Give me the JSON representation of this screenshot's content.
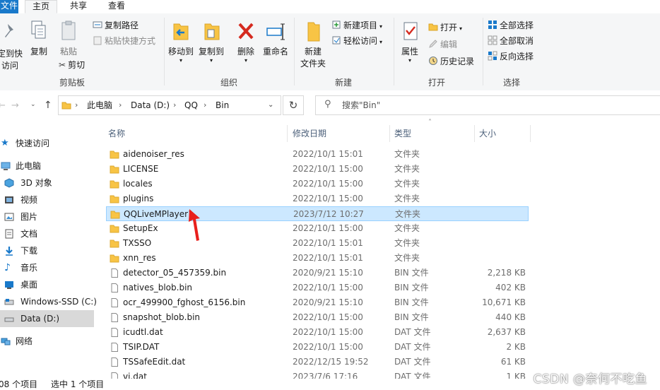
{
  "ribbon_tabs": {
    "file": "文件",
    "home": "主页",
    "share": "共享",
    "view": "查看"
  },
  "ribbon": {
    "clipboard": {
      "pin_label_1": "定到快",
      "pin_label_2": "访问",
      "copy": "复制",
      "paste": "粘贴",
      "copy_path": "复制路径",
      "paste_shortcut": "粘贴快捷方式",
      "cut": "剪切",
      "group": "剪贴板"
    },
    "organize": {
      "move_to": "移动到",
      "copy_to": "复制到",
      "delete": "删除",
      "rename": "重命名",
      "group": "组织"
    },
    "new": {
      "new_folder_1": "新建",
      "new_folder_2": "文件夹",
      "new_item": "新建项目",
      "easy_access": "轻松访问",
      "group": "新建"
    },
    "open": {
      "properties": "属性",
      "open": "打开",
      "edit": "编辑",
      "history": "历史记录",
      "group": "打开"
    },
    "select": {
      "select_all": "全部选择",
      "select_none": "全部取消",
      "invert": "反向选择",
      "group": "选择"
    }
  },
  "address": {
    "breadcrumbs": [
      "此电脑",
      "Data (D:)",
      "QQ",
      "Bin"
    ],
    "search_placeholder": "搜索\"Bin\""
  },
  "nav_pane": [
    {
      "label": "快速访问",
      "icon": "star-icon"
    },
    {
      "label": "此电脑",
      "icon": "computer-icon"
    },
    {
      "label": "3D 对象",
      "icon": "3d-objects-icon"
    },
    {
      "label": "视频",
      "icon": "video-icon"
    },
    {
      "label": "图片",
      "icon": "pictures-icon"
    },
    {
      "label": "文档",
      "icon": "documents-icon"
    },
    {
      "label": "下载",
      "icon": "download-icon"
    },
    {
      "label": "音乐",
      "icon": "music-icon"
    },
    {
      "label": "桌面",
      "icon": "desktop-icon"
    },
    {
      "label": "Windows-SSD (C:)",
      "icon": "drive-icon"
    },
    {
      "label": "Data (D:)",
      "icon": "drive-icon"
    },
    {
      "label": "网络",
      "icon": "network-icon"
    }
  ],
  "columns": {
    "name": "名称",
    "date": "修改日期",
    "type": "类型",
    "size": "大小"
  },
  "files": [
    {
      "name": "aidenoiser_res",
      "date": "2022/10/1 15:01",
      "type": "文件夹",
      "size": "",
      "kind": "folder"
    },
    {
      "name": "LICENSE",
      "date": "2022/10/1 15:00",
      "type": "文件夹",
      "size": "",
      "kind": "folder"
    },
    {
      "name": "locales",
      "date": "2022/10/1 15:00",
      "type": "文件夹",
      "size": "",
      "kind": "folder"
    },
    {
      "name": "plugins",
      "date": "2022/10/1 15:00",
      "type": "文件夹",
      "size": "",
      "kind": "folder"
    },
    {
      "name": "QQLiveMPlayer1",
      "date": "2023/7/12 10:27",
      "type": "文件夹",
      "size": "",
      "kind": "folder",
      "selected": true
    },
    {
      "name": "SetupEx",
      "date": "2022/10/1 15:00",
      "type": "文件夹",
      "size": "",
      "kind": "folder"
    },
    {
      "name": "TXSSO",
      "date": "2022/10/1 15:01",
      "type": "文件夹",
      "size": "",
      "kind": "folder"
    },
    {
      "name": "xnn_res",
      "date": "2022/10/1 15:01",
      "type": "文件夹",
      "size": "",
      "kind": "folder"
    },
    {
      "name": "detector_05_457359.bin",
      "date": "2020/9/21 15:10",
      "type": "BIN 文件",
      "size": "2,218 KB",
      "kind": "file"
    },
    {
      "name": "natives_blob.bin",
      "date": "2022/10/1 15:00",
      "type": "BIN 文件",
      "size": "402 KB",
      "kind": "file"
    },
    {
      "name": "ocr_499900_fghost_6156.bin",
      "date": "2020/9/21 15:10",
      "type": "BIN 文件",
      "size": "10,671 KB",
      "kind": "file"
    },
    {
      "name": "snapshot_blob.bin",
      "date": "2022/10/1 15:00",
      "type": "BIN 文件",
      "size": "440 KB",
      "kind": "file"
    },
    {
      "name": "icudtl.dat",
      "date": "2022/10/1 15:00",
      "type": "DAT 文件",
      "size": "2,637 KB",
      "kind": "file"
    },
    {
      "name": "TSIP.DAT",
      "date": "2022/10/1 15:00",
      "type": "DAT 文件",
      "size": "2 KB",
      "kind": "file"
    },
    {
      "name": "TSSafeEdit.dat",
      "date": "2022/12/15 19:52",
      "type": "DAT 文件",
      "size": "61 KB",
      "kind": "file"
    },
    {
      "name": "vi.dat",
      "date": "2023/7/6 17:16",
      "type": "DAT 文件",
      "size": "1 KB",
      "kind": "file"
    }
  ],
  "status": {
    "count": "08 个项目",
    "selected": "选中 1 个项目"
  },
  "watermark": "CSDN @奈何不吃鱼",
  "colors": {
    "accent": "#1979ca",
    "selection": "#cce8ff",
    "folder": "#f8c445",
    "annotation_arrow": "#e8201d"
  }
}
